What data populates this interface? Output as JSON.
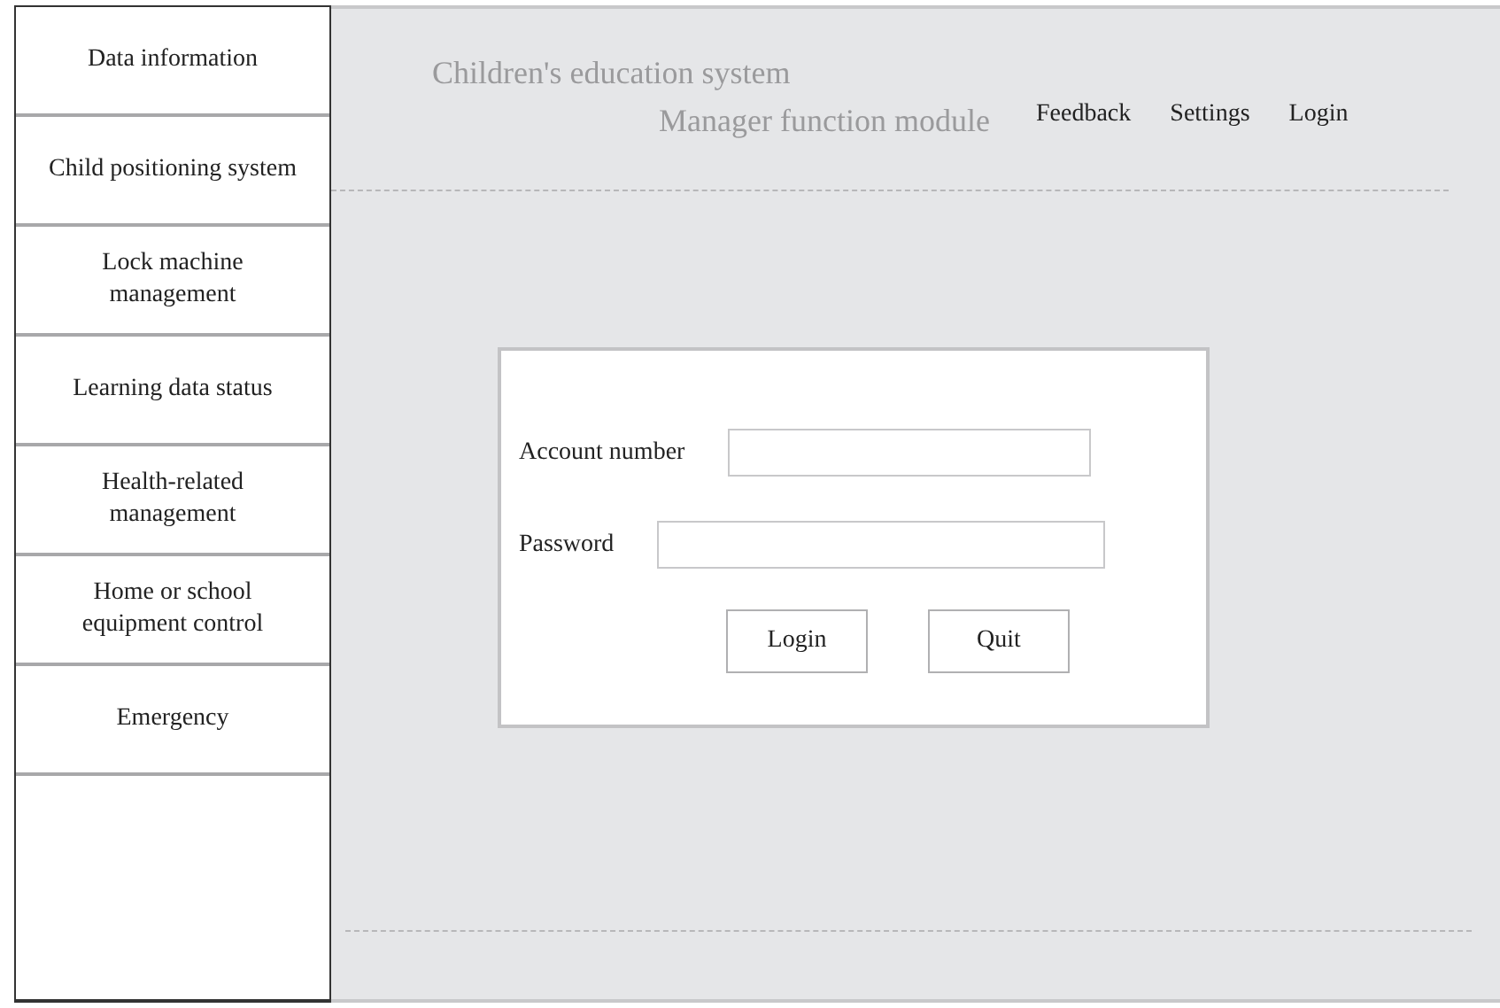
{
  "sidebar": {
    "items": [
      {
        "label": "Data information"
      },
      {
        "label": "Child positioning system"
      },
      {
        "label": "Lock machine management"
      },
      {
        "label": "Learning data status"
      },
      {
        "label": "Health-related management"
      },
      {
        "label": "Home or school equipment control"
      },
      {
        "label": "Emergency"
      }
    ]
  },
  "header": {
    "title": "Children's education system",
    "subtitle": "Manager function module",
    "nav": [
      "Feedback",
      "Settings",
      "Login"
    ]
  },
  "login_form": {
    "fields": [
      {
        "label": "Account number"
      },
      {
        "label": "Password"
      }
    ],
    "buttons": [
      "Login",
      "Quit"
    ]
  }
}
